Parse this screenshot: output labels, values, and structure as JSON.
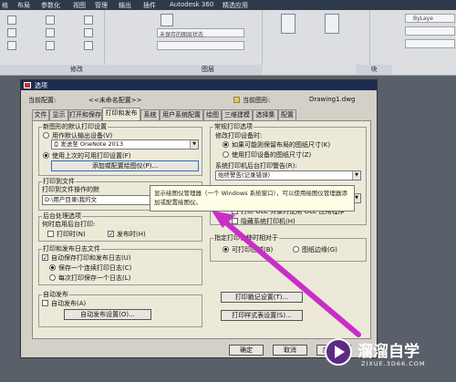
{
  "menubar": {
    "items": [
      "格",
      "布局",
      "参数化",
      "视图",
      "管理",
      "输出",
      "插件",
      "Autodesk 360",
      "精选应用"
    ]
  },
  "ribbon": {
    "panels": [
      {
        "label": "修改"
      },
      {
        "label": "图层"
      },
      {
        "label": "块"
      }
    ],
    "layer_state": "未保存的图层状态",
    "bylayer": "ByLaye"
  },
  "dialog": {
    "title": "选项",
    "current_profile_label": "当前配置:",
    "current_profile_value": "<<未命名配置>>",
    "current_drawing_label": "当前图形:",
    "current_drawing_value": "Drawing1.dwg",
    "tabs": [
      "文件",
      "显示",
      "打开和保存",
      "打印和发布",
      "系统",
      "用户系统配置",
      "绘图",
      "三维建模",
      "选择集",
      "配置"
    ],
    "new_drawing_group": "新图形的默认打印设置",
    "radio_default_output": "用作默认输出设备(V)",
    "printer_value": "发送至 OneNote 2013",
    "radio_last_settings": "使用上次的可用打印设置(F)",
    "btn_add_plotter": "添加或配置绘图仪(P)...",
    "print_to_file_group": "打印到文件",
    "print_to_file_label": "打印到文件操作的默",
    "print_path": "D:\\用户目录\\我的文",
    "bg_group": "后台处理选项",
    "bg_label": "何时启用后台打印:",
    "chk_plot": "打印时(N)",
    "chk_publish": "发布时(H)",
    "log_group": "打印和发布日志文件",
    "chk_autosave_log": "自动保存打印和发布日志(U)",
    "radio_one_log": "保存一个连续打印日志(C)",
    "radio_each_log": "每次打印保存一个日志(L)",
    "autopublish_group": "自动发布",
    "chk_autopublish": "自动发布(A)",
    "btn_autopublish": "自动发布设置(O)...",
    "general_group": "常规打印选项",
    "modify_label": "修改打印设备时:",
    "radio_keep_layout": "如果可能则保留布局的图纸尺寸(K)",
    "radio_use_device": "使用打印设备的图纸尺寸(Z)",
    "spool_label": "系统打印机后台打印警告(R):",
    "spool_value": "始终警告(记录错误)",
    "ole_select_value": "",
    "chk_ole": "打印 OLE 对象时使用 OLE 应用程序",
    "chk_hide_sys": "隐藏系统打印机(H)",
    "offset_group": "指定打印偏移时相对于",
    "radio_printable": "可打印区域(B)",
    "radio_paper_edge": "图纸边缘(G)",
    "btn_stamp": "打印戳记设置(T)...",
    "btn_style": "打印样式表设置(S)...",
    "btn_ok": "确定",
    "btn_cancel": "取消",
    "btn_apply": "应用(A)",
    "tooltip": "显示绘图仪管理器（一个 Windows 系统窗口），可以使用绘图仪管理器添加或配置绘图仪。"
  },
  "watermark": {
    "text": "溜溜自学",
    "url": "ZIXUE.3D66.COM"
  },
  "colors": {
    "accent_arrow": "#c92ec9",
    "title_bar": "#1c2d52",
    "watermark_bg": "#5b2b84"
  }
}
